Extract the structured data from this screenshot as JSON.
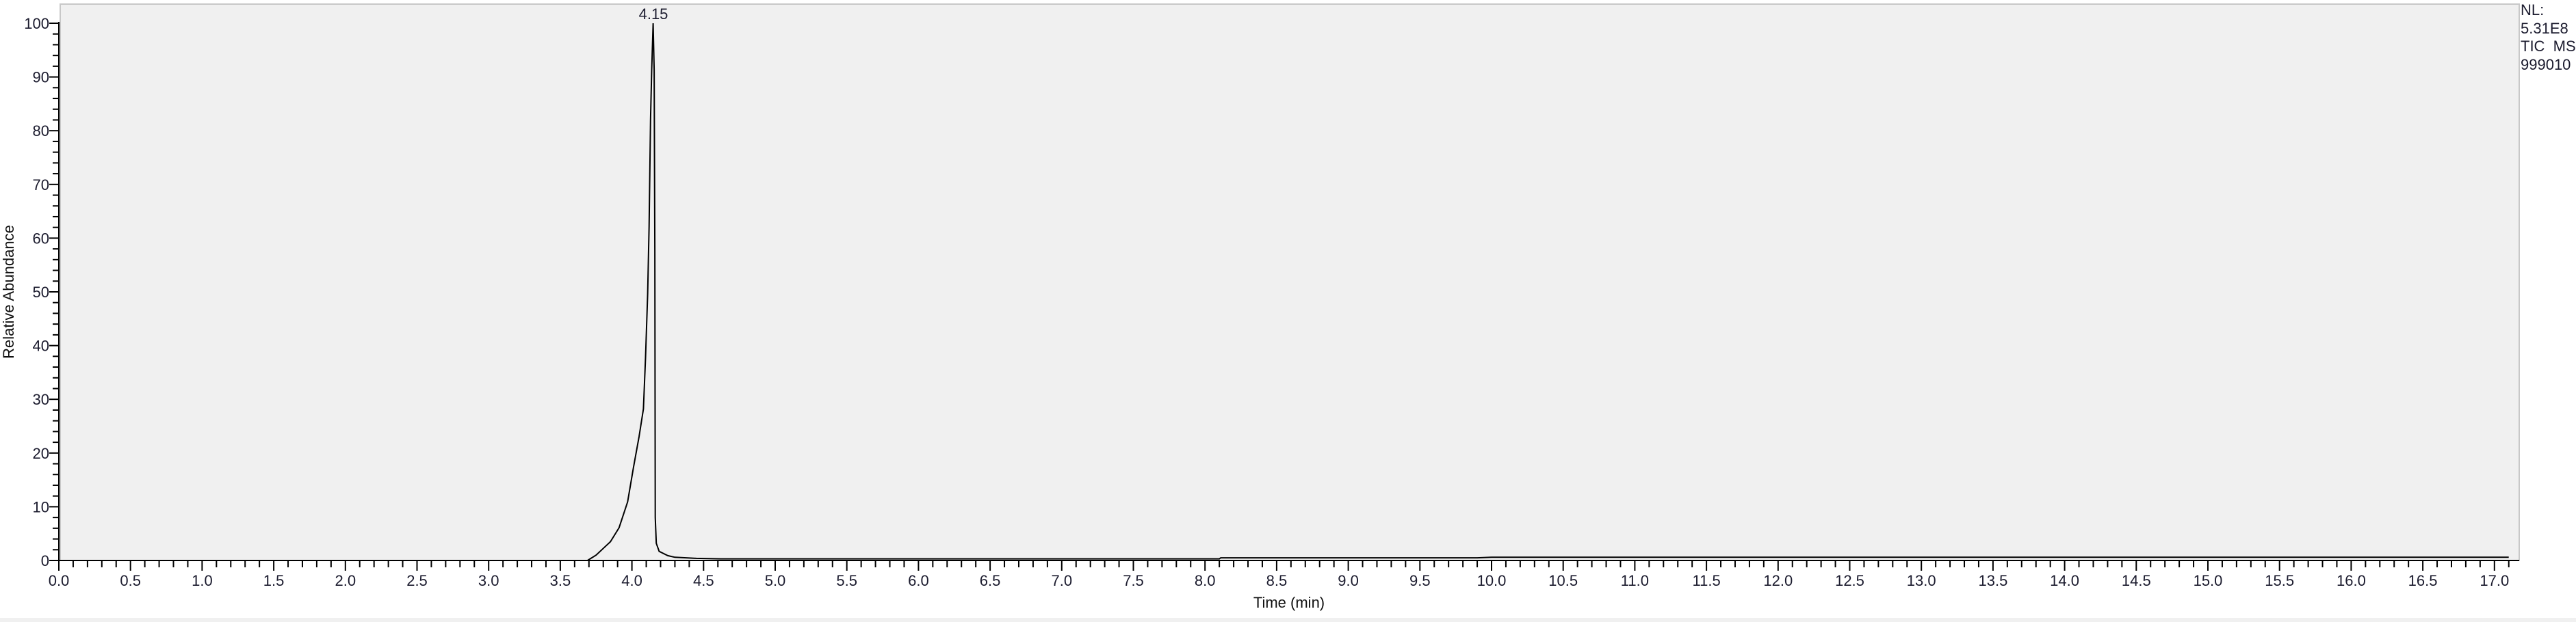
{
  "chart_data": {
    "type": "line",
    "title": "",
    "xlabel": "Time (min)",
    "ylabel": "Relative Abundance",
    "xlim": [
      0,
      17.17
    ],
    "ylim": [
      0,
      100
    ],
    "x_major_step": 0.5,
    "x_minor_step": 0.1,
    "y_major_step": 10,
    "y_minor_step": 2,
    "grid": false,
    "peak_labels": [
      {
        "x": 4.15,
        "y": 100,
        "text": "4.15"
      }
    ],
    "series": [
      {
        "name": "TIC MS",
        "color": "#000000",
        "x": [
          3.0,
          3.69,
          3.75,
          3.85,
          3.91,
          3.97,
          4.01,
          4.05,
          4.08,
          4.095,
          4.11,
          4.12,
          4.13,
          4.138,
          4.148,
          4.155,
          4.16,
          4.163,
          4.17,
          4.19,
          4.25,
          4.3,
          4.45,
          4.62,
          6.0,
          8.1,
          8.11,
          9.9,
          10.0,
          12.0,
          14.0,
          16.0,
          17.1
        ],
        "y": [
          0,
          0,
          1.0,
          3.5,
          6.1,
          10.9,
          17.2,
          23.1,
          28.2,
          37.8,
          49.6,
          62.2,
          82.0,
          91.3,
          100,
          91.3,
          57.7,
          8.0,
          3.2,
          1.7,
          0.9,
          0.6,
          0.4,
          0.3,
          0.3,
          0.3,
          0.5,
          0.5,
          0.6,
          0.6,
          0.6,
          0.6,
          0.6
        ]
      }
    ]
  },
  "info": {
    "nl_label": "NL:",
    "nl_value": "5.31E8",
    "scan_type": "TIC  MS",
    "sample": "999010"
  },
  "colors": {
    "plot_bg": "#f0f0f0",
    "frame": "#c8c8c8",
    "axis": "#000000"
  }
}
